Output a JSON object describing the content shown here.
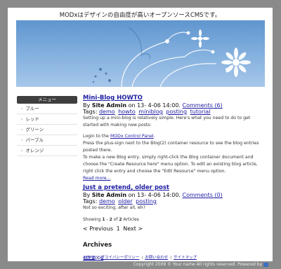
{
  "site": {
    "title": "MODxはデザインの自由度が高いオープンソースCMSです。"
  },
  "menu": {
    "header": "メニュー",
    "items": [
      {
        "label": "ブルー"
      },
      {
        "label": "レッド"
      },
      {
        "label": "グリーン"
      },
      {
        "label": "パープル"
      },
      {
        "label": "オレンジ"
      }
    ]
  },
  "posts": [
    {
      "title": "Mini-Blog HOWTO",
      "by": "By",
      "author": "Site Admin",
      "date": "on 13- 4-06 14:00.",
      "comments": "Comments (6)",
      "tags_label": "Tags:",
      "tags": [
        "demo",
        "howto",
        "miniblog",
        "posting",
        "tutorial"
      ],
      "body1": "Setting up a mini-blog is relatively simple. Here's what you need to do to get started with making new posts:",
      "body2_prefix": "Login to the",
      "body2_link": "MODx Control Panel",
      "body2_suffix": ".",
      "body3": "Press the plus-sign next to the Blog(2) container resource to see the blog entries posted there.",
      "body4": "To make a new Blog entry, simply right-click the Blog container document and choose the \"Create Resource here\" menu option. To edit an existing blog article, right click the entry and choose the \"Edit Resource\" menu option.",
      "read_more": "Read more..."
    },
    {
      "title": "Just a pretend, older post",
      "by": "By",
      "author": "Site Admin",
      "date": "on 13- 4-06 14:00.",
      "comments": "Comments (0)",
      "tags_label": "Tags:",
      "tags": [
        "demo",
        "older",
        "posting"
      ],
      "body1": "Not so exciting, after all, eh?"
    }
  ],
  "pager": {
    "info_prefix": "Showing",
    "from": "1",
    "dash": "-",
    "to": "2",
    "of": "of",
    "total": "2",
    "suffix": "Articles",
    "prev": "< Previous",
    "one": "1",
    "next": "Next >"
  },
  "archives": {
    "heading": "Archives",
    "link": "4月 2006"
  },
  "footer": {
    "links": [
      "HOME",
      "プライバシーポリシー",
      "お問い合わせ",
      "サイトマップ"
    ],
    "copyright": "Copyright 2009 © Your name All rights reserved. Powered by"
  },
  "colors": {
    "link": "#1d1da3",
    "menu_header_bg": "#3f3f3f",
    "banner_top": "#5f95cf",
    "banner_bottom": "#a7c7ea",
    "outer_bg": "#8a8a8a"
  }
}
